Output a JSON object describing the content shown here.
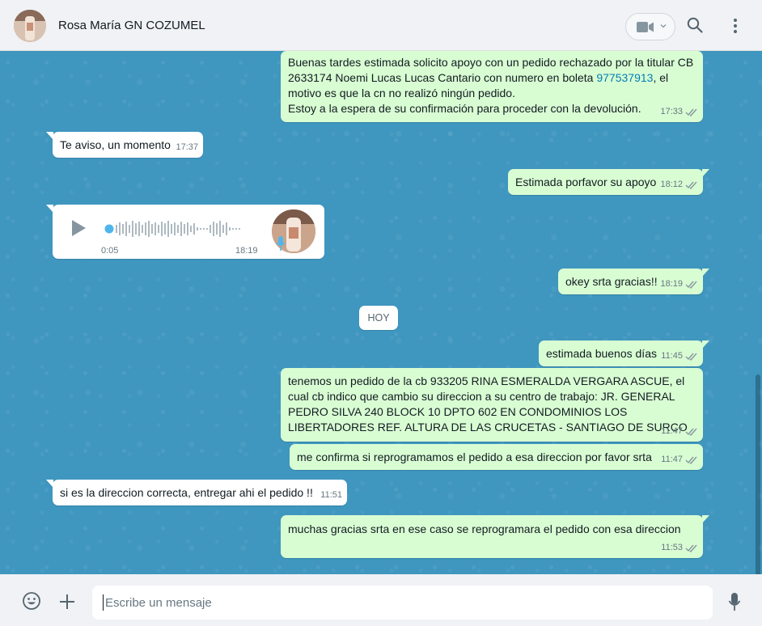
{
  "header": {
    "contact_name": "Rosa María GN COZUMEL"
  },
  "messages": {
    "m1": {
      "direction": "out",
      "text_before_link": "Buenas tardes estimada solicito apoyo con un pedido rechazado por la titular CB 2633174 Noemi Lucas Lucas Cantario con numero en boleta ",
      "link": "977537913",
      "text_after_link": ", el motivo es que la cn no realizó ningún pedido.\nEstoy a la espera de su confirmación para proceder con la devolución.",
      "time": "17:33"
    },
    "m2": {
      "direction": "in",
      "text": "Te aviso, un momento",
      "time": "17:37"
    },
    "m3": {
      "direction": "out",
      "text": "Estimada porfavor su apoyo",
      "time": "18:12"
    },
    "m4": {
      "direction": "in",
      "type": "voice",
      "duration": "0:05",
      "time": "18:19"
    },
    "m5": {
      "direction": "out",
      "text": "okey srta gracias!!",
      "time": "18:19"
    },
    "date_badge": "HOY",
    "m6": {
      "direction": "out",
      "text": "estimada buenos días",
      "time": "11:45"
    },
    "m7": {
      "direction": "out",
      "text": "tenemos un pedido de la cb 933205 RINA ESMERALDA VERGARA ASCUE, el cual cb indico que cambio su direccion a su centro de trabajo: JR. GENERAL PEDRO SILVA 240 BLOCK 10 DPTO 602 EN CONDOMINIOS LOS LIBERTADORES REF. ALTURA DE LAS CRUCETAS - SANTIAGO DE SURCO",
      "time": "11:47"
    },
    "m8": {
      "direction": "out",
      "text": "me confirma si reprogramamos el pedido a esa direccion por favor srta",
      "time": "11:47"
    },
    "m9": {
      "direction": "in",
      "text": "si es la direccion correcta, entregar ahi el pedido !!",
      "time": "11:51"
    },
    "m10": {
      "direction": "out",
      "text": "muchas gracias srta en ese caso se reprogramara el pedido con esa direccion",
      "time": "11:53"
    }
  },
  "composer": {
    "placeholder": "Escribe un mensaje"
  },
  "colors": {
    "outgoing_bubble": "#d9fdd3",
    "incoming_bubble": "#ffffff",
    "chat_background": "#3f96bf",
    "read_ticks": "#8696a0",
    "link": "#027eb5"
  },
  "icons": [
    "video-call-icon",
    "search-icon",
    "menu-icon",
    "play-icon",
    "mic-icon",
    "emoji-icon",
    "attach-icon",
    "read-ticks-icon"
  ]
}
